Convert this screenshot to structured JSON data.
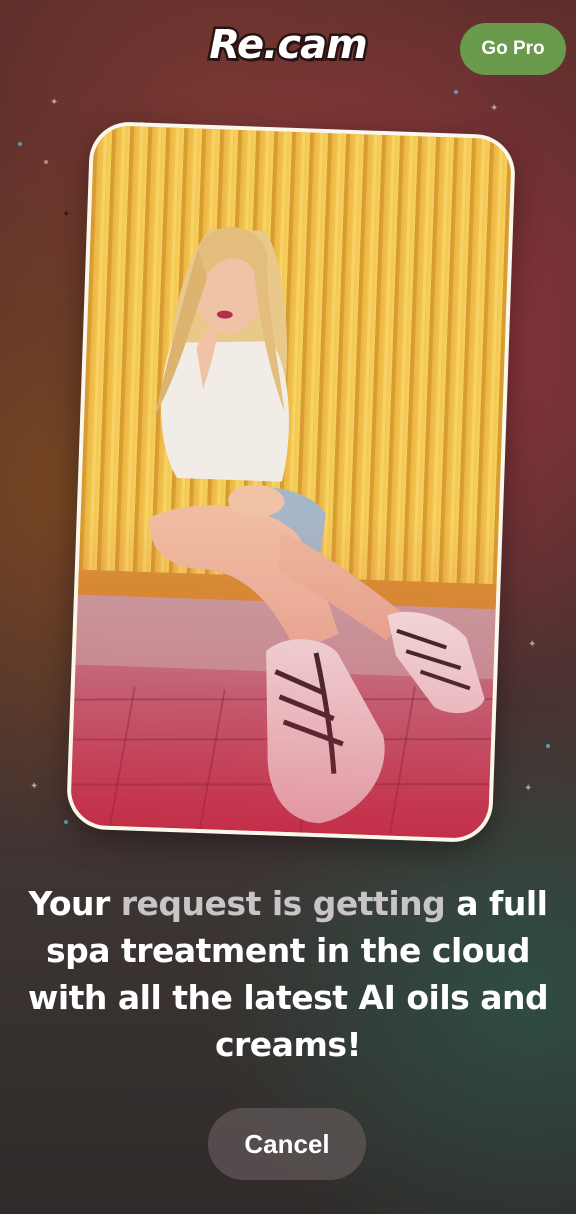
{
  "header": {
    "logo": "Re.cam",
    "go_pro_label": "Go Pro"
  },
  "preview": {
    "image_icon": "photo-preview"
  },
  "message": {
    "part1": "Your ",
    "highlight": "request is getting",
    "part2": " a full spa treatment in the cloud with all the latest AI oils and creams!"
  },
  "actions": {
    "cancel_label": "Cancel"
  },
  "colors": {
    "accent_green": "#6a9a4c",
    "cancel_bg": "#5a5252",
    "highlight_text": "#c9c4c6"
  }
}
